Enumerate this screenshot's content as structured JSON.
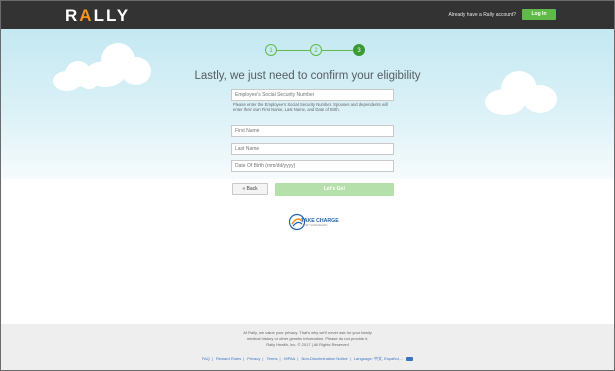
{
  "header": {
    "logo_text_left": "R",
    "logo_text_accent": "A",
    "logo_text_right": "LLY",
    "already_have_account": "Already have a Rally account?",
    "login_label": "Log In"
  },
  "steps": [
    {
      "label": "1",
      "state": "complete"
    },
    {
      "label": "2",
      "state": "complete"
    },
    {
      "label": "3",
      "state": "current"
    }
  ],
  "form": {
    "heading": "Lastly, we just need to confirm your eligibility",
    "ssn_placeholder": "Employee's Social Security Number",
    "ssn_helper": "Please enter the Employee's Social Security Number. Spouses and dependents will enter their own First Name, Last Name, and Date of Birth.",
    "first_name_placeholder": "First Name",
    "last_name_placeholder": "Last Name",
    "dob_placeholder": "Date Of Birth (mm/dd/yyyy)",
    "back_label": "« Back",
    "submit_label": "Let's Go!"
  },
  "partner_logo": {
    "line1": "TAKE CHARGE",
    "line2": "FOR YOUR HEALTH"
  },
  "footer": {
    "privacy_line1": "At Rally, we value your privacy. That's why we'll never ask for your family",
    "privacy_line2": "medical history or other genetic information. Please do not provide it.",
    "copyright": "Rally Health, Inc. © 2017 | All Rights Reserved",
    "links": [
      "FAQ",
      "Reward Rules",
      "Privacy",
      "Terms",
      "HIPAA",
      "Non-Discrimination Notice",
      "Language: 中文, Español,..."
    ],
    "separator": "|"
  },
  "colors": {
    "topbar": "#333333",
    "brand_accent": "#f7941d",
    "primary_green": "#5fba47",
    "disabled_green": "#b6e0ab",
    "sky": "#c4e8f2",
    "footer_bg": "#eeeeee",
    "link": "#3b74c4"
  }
}
